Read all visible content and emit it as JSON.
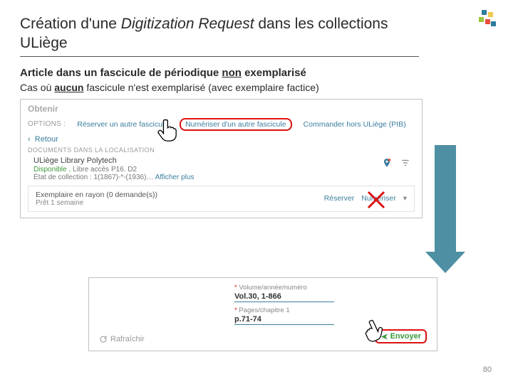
{
  "title_parts": {
    "pre": "Création d'une ",
    "it": "Digitization Request",
    "post": " dans les collections ULiège"
  },
  "subtitle_parts": {
    "pre": "Article dans un fascicule de périodique ",
    "non": "non",
    "post": " exemplarisé"
  },
  "case_parts": {
    "pre": "Cas où ",
    "aucun": "aucun",
    "post": " fascicule n'est exemplarisé (avec exemplaire factice)"
  },
  "panel1": {
    "obtenir": "Obtenir",
    "options_label": "OPTIONS :",
    "opt_reserve": "Réserver un autre fascicule",
    "opt_numeriser": "Numériser d'un autre fascicule",
    "opt_pib": "Commander hors ULiège (PIB)",
    "retour": "Retour",
    "docs": "DOCUMENTS DANS LA LOCALISATION",
    "loc_name": "ULiège Library  Polytech",
    "dispo_pre": "Disponible ,",
    "p16": " Libre accès P16. D2",
    "etat": "État de collection :  1(1867)-*-(1936)… ",
    "affplus": "Afficher plus",
    "item_title": "Exemplaire en rayon (0 demande(s))",
    "pret": "Prêt 1 semaine",
    "reserv": "Réserver",
    "numer": "Numériser"
  },
  "panel2": {
    "label_vol": "Volume/année/numéro",
    "val_vol": "Vol.30, 1-866",
    "label_pages": "Pages/chapitre 1",
    "val_pages": "p.71-74",
    "refresh": "Rafraîchir",
    "envoyer": "Envoyer"
  },
  "pagenum": "80"
}
